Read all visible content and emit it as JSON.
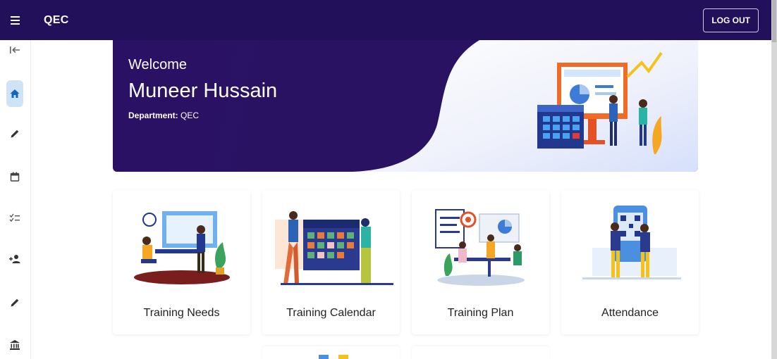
{
  "header": {
    "title": "QEC",
    "logout_label": "LOG OUT"
  },
  "sidebar": {
    "items": [
      {
        "name": "collapse-icon"
      },
      {
        "name": "home-icon",
        "active": true
      },
      {
        "name": "pencil-icon"
      },
      {
        "name": "calendar-icon"
      },
      {
        "name": "checklist-icon"
      },
      {
        "name": "add-user-icon"
      },
      {
        "name": "pencil-icon"
      },
      {
        "name": "institution-icon"
      }
    ]
  },
  "hero": {
    "welcome": "Welcome",
    "user_name": "Muneer Hussain",
    "department_label": "Department:",
    "department_value": "QEC"
  },
  "cards": [
    {
      "label": "Training Needs"
    },
    {
      "label": "Training Calendar"
    },
    {
      "label": "Training Plan"
    },
    {
      "label": "Attendance"
    }
  ],
  "colors": {
    "header_bg": "#22105a",
    "hero_bg": "#2b1165",
    "active_nav_bg": "#cfe3f6",
    "active_nav_icon": "#1565c0"
  }
}
